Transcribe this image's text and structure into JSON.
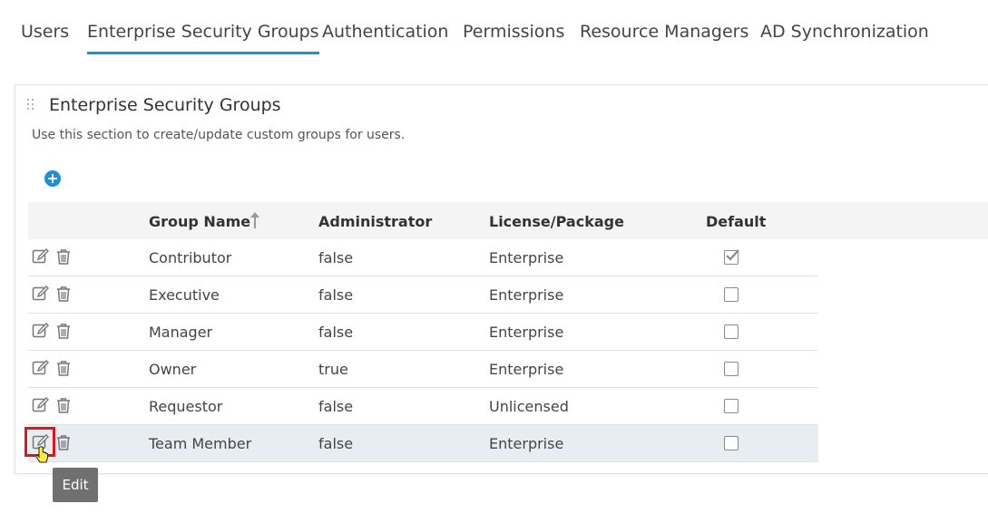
{
  "tabs": [
    {
      "label": "Users"
    },
    {
      "label": "Enterprise Security Groups",
      "active": true
    },
    {
      "label": "Authentication"
    },
    {
      "label": "Permissions"
    },
    {
      "label": "Resource Managers"
    },
    {
      "label": "AD Synchronization"
    }
  ],
  "panel": {
    "title": "Enterprise Security Groups",
    "description": "Use this section to create/update custom groups for users.",
    "add_icon": "plus-circle-icon"
  },
  "table": {
    "columns": [
      "Group Name",
      "Administrator",
      "License/Package",
      "Default"
    ],
    "sort_column": "Group Name",
    "sort_direction": "ascending",
    "rows": [
      {
        "name": "Contributor",
        "administrator": "false",
        "license": "Enterprise",
        "default": true
      },
      {
        "name": "Executive",
        "administrator": "false",
        "license": "Enterprise",
        "default": false
      },
      {
        "name": "Manager",
        "administrator": "false",
        "license": "Enterprise",
        "default": false
      },
      {
        "name": "Owner",
        "administrator": "true",
        "license": "Enterprise",
        "default": false
      },
      {
        "name": "Requestor",
        "administrator": "false",
        "license": "Unlicensed",
        "default": false
      },
      {
        "name": "Team Member",
        "administrator": "false",
        "license": "Enterprise",
        "default": false
      }
    ]
  },
  "tooltip": {
    "text": "Edit"
  },
  "colors": {
    "accent": "#1e90d6",
    "highlight_row": "#e8edf2",
    "focus_border": "#e0141a"
  }
}
